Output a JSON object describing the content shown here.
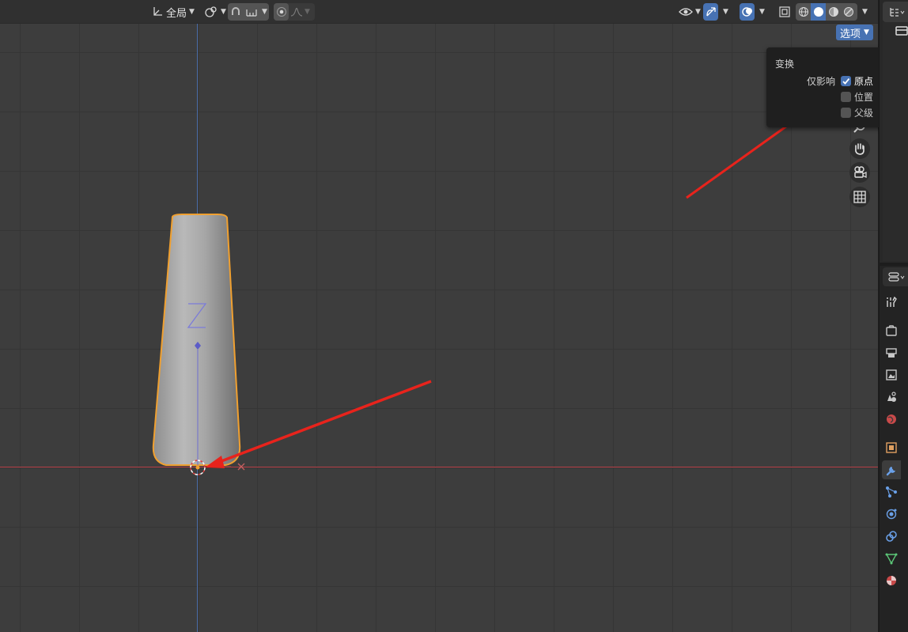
{
  "header": {
    "transform_orientation_label": "全局",
    "options_label": "选项"
  },
  "popup": {
    "title": "变换",
    "affect_only_label": "仅影响",
    "items": [
      {
        "label": "原点",
        "checked": true
      },
      {
        "label": "位置",
        "checked": false
      },
      {
        "label": "父级",
        "checked": false
      }
    ]
  },
  "viewport": {
    "z_axis_label": "Z",
    "x_axis_label": "X"
  },
  "icons": {
    "transform-orientation": "transform-orientation-icon",
    "pivot": "pivot-point-icon",
    "snap": "snap-icon",
    "proportional": "proportional-editing-icon",
    "visibility": "object-visibility-icon",
    "gizmo": "gizmo-icon",
    "overlay": "overlay-icon",
    "xray": "xray-icon",
    "shading": [
      "wireframe-icon",
      "solid-icon",
      "material-preview-icon",
      "rendered-icon"
    ],
    "nav": [
      "zoom-icon",
      "hand-pan-icon",
      "camera-view-icon",
      "ortho-grid-icon"
    ],
    "properties_tabs": [
      "tool-icon",
      "render-icon",
      "output-icon",
      "view-layer-icon",
      "scene-icon",
      "world-icon",
      "object-icon",
      "modifier-icon",
      "particles-icon",
      "physics-icon",
      "constraints-icon",
      "data-icon",
      "material-icon"
    ]
  },
  "colors": {
    "accent": "#4772b3",
    "selection_outline": "#f0a030",
    "x_axis": "#b8424a",
    "y_axis": "#4b6ea8",
    "annotation_arrow": "#e8231c"
  }
}
